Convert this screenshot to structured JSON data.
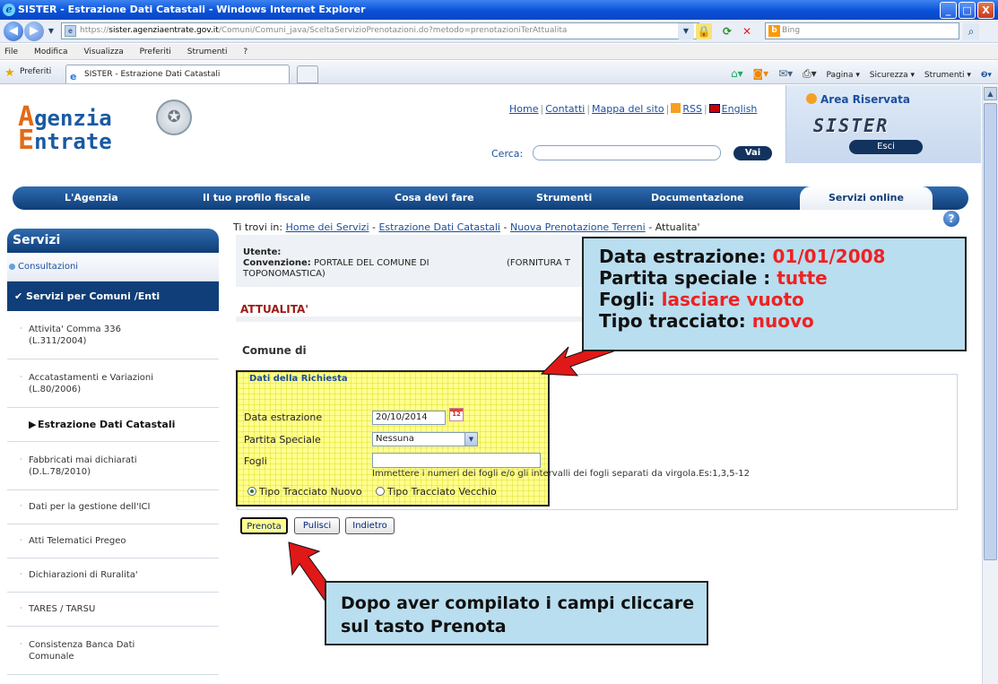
{
  "window": {
    "title": "SISTER - Estrazione Dati Catastali - Windows Internet Explorer",
    "minimize": "_",
    "maximize": "□",
    "close": "X"
  },
  "browser": {
    "address_prefix": "https://",
    "address_host": "sister.agenziaentrate.gov.it",
    "address_path": "/Comuni/Comuni_java/SceltaServizioPrenotazioni.do?metodo=prenotazioniTerAttualita",
    "search_engine": "Bing",
    "menu": [
      "File",
      "Modifica",
      "Visualizza",
      "Preferiti",
      "Strumenti",
      "?"
    ],
    "favorites_label": "Preferiti",
    "tab_title": "SISTER - Estrazione Dati Catastali",
    "commands": [
      "Pagina ▾",
      "Sicurezza ▾",
      "Strumenti ▾"
    ]
  },
  "header": {
    "logo_line1_initial": "A",
    "logo_line1": "genzia",
    "logo_line2_initial": "E",
    "logo_line2": "ntrate",
    "links": [
      "Home",
      "Contatti",
      "Mappa del sito",
      "RSS",
      "English"
    ],
    "search_label": "Cerca:",
    "search_button": "Vai",
    "area_title": "Area Riservata",
    "area_brand": "SISTER",
    "logout_button": "Esci"
  },
  "nav": {
    "items": [
      "L'Agenzia",
      "Il tuo profilo fiscale",
      "Cosa devi fare",
      "Strumenti",
      "Documentazione",
      "Servizi online"
    ],
    "active_index": 5
  },
  "breadcrumb": {
    "prefix": "Ti trovi in:",
    "items": [
      "Home dei Servizi",
      "Estrazione Dati Catastali",
      "Nuova Prenotazione Terreni"
    ],
    "current": "Attualita'"
  },
  "sidebar": {
    "title": "Servizi",
    "consultazioni": "Consultazioni",
    "section": "Servizi per Comuni /Enti",
    "items": [
      {
        "label": "Attivita' Comma 336",
        "sub": "(L.311/2004)"
      },
      {
        "label": "Accatastamenti e Variazioni",
        "sub": "(L.80/2006)"
      },
      {
        "label": "Estrazione Dati Catastali",
        "sub": ""
      },
      {
        "label": "Fabbricati mai dichiarati",
        "sub": "(D.L.78/2010)"
      },
      {
        "label": "Dati per la gestione dell'ICI",
        "sub": ""
      },
      {
        "label": "Atti Telematici Pregeo",
        "sub": ""
      },
      {
        "label": "Dichiarazioni di Ruralita'",
        "sub": ""
      },
      {
        "label": "TARES / TARSU",
        "sub": ""
      },
      {
        "label": "Consistenza Banca Dati",
        "sub": "Comunale"
      }
    ],
    "selected_index": 2
  },
  "user": {
    "utente_label": "Utente:",
    "convenzione_label": "Convenzione:",
    "convenzione_value": "PORTALE DEL COMUNE DI",
    "fornitura": "(FORNITURA T",
    "line3": "TOPONOMASTICA)"
  },
  "page": {
    "section_title": "ATTUALITA'",
    "comune_label": "Comune di"
  },
  "form": {
    "legend": "Dati della Richiesta",
    "data_label": "Data estrazione",
    "data_value": "20/10/2014",
    "partita_label": "Partita Speciale",
    "partita_value": "Nessuna",
    "fogli_label": "Fogli",
    "fogli_value": "",
    "fogli_hint": "Immettere i numeri dei fogli e/o gli intervalli dei fogli separati da virgola.Es:1,3,5-12",
    "radio_nuovo": "Tipo Tracciato Nuovo",
    "radio_vecchio": "Tipo Tracciato Vecchio",
    "radio_selected": "nuovo",
    "btn_prenota": "Prenota",
    "btn_pulisci": "Pulisci",
    "btn_indietro": "Indietro"
  },
  "callout1": {
    "l1_label": "Data estrazione:",
    "l1_value": "01/01/2008",
    "l2_label": "Partita speciale :",
    "l2_value": "tutte",
    "l3_label": "Fogli:",
    "l3_value": "lasciare vuoto",
    "l4_label": "Tipo tracciato:",
    "l4_value": "nuovo"
  },
  "callout2": {
    "line1": "Dopo aver compilato i campi cliccare",
    "line2": "sul tasto Prenota"
  },
  "colors": {
    "accent": "#0f3e78",
    "highlight": "#fffe8f",
    "callout_bg": "#b9deef",
    "callout_value": "#e22222",
    "arrow": "#e01818"
  }
}
